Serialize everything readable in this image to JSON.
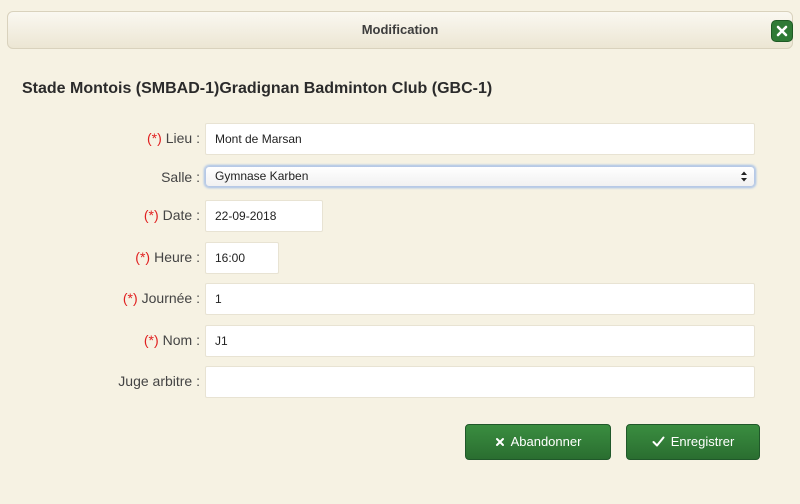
{
  "dialog": {
    "title": "Modification",
    "close_icon": "close-icon"
  },
  "match": {
    "title": "Stade Montois (SMBAD-1)Gradignan Badminton Club (GBC-1)"
  },
  "form": {
    "required_marker": "(*)",
    "lieu": {
      "label": "Lieu :",
      "value": "Mont de Marsan"
    },
    "salle": {
      "label": "Salle :",
      "value": "Gymnase Karben"
    },
    "date": {
      "label": "Date :",
      "value": "22-09-2018"
    },
    "heure": {
      "label": "Heure :",
      "value": "16:00"
    },
    "journee": {
      "label": "Journée :",
      "value": "1"
    },
    "nom": {
      "label": "Nom :",
      "value": "J1"
    },
    "juge": {
      "label": "Juge arbitre :",
      "value": ""
    }
  },
  "actions": {
    "cancel_label": "Abandonner",
    "cancel_icon": "x-icon",
    "save_label": "Enregistrer",
    "save_icon": "check-icon"
  },
  "colors": {
    "accent": "#2f7a35",
    "required": "#e02020",
    "background": "#f6f2e3"
  }
}
